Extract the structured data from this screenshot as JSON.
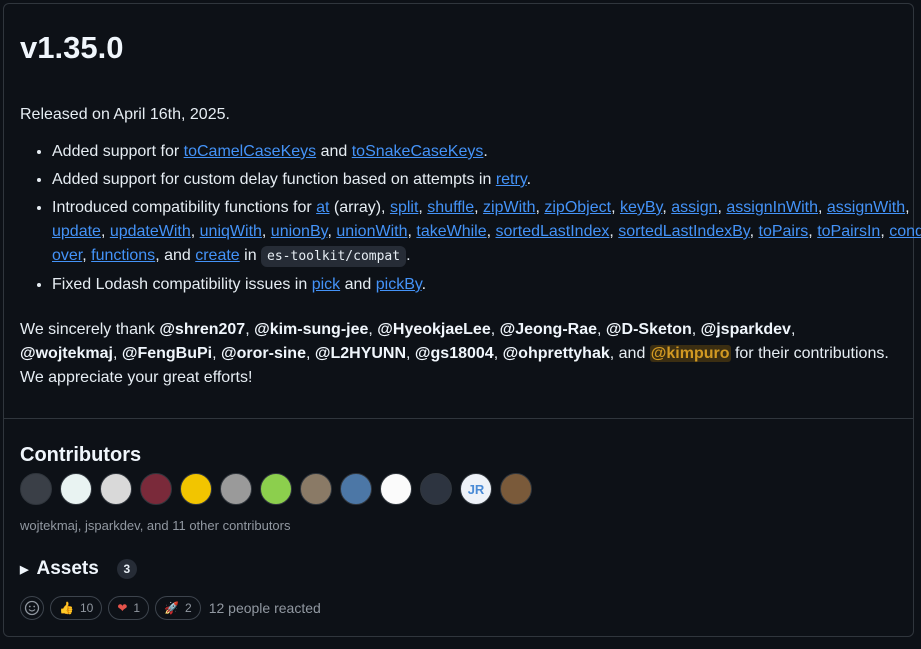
{
  "release": {
    "title": "v1.35.0",
    "released": "Released on April 16th, 2025."
  },
  "bullets": {
    "b1": {
      "pre": "Added support for ",
      "link1": "toCamelCaseKeys",
      "mid": " and ",
      "link2": "toSnakeCaseKeys",
      "post": "."
    },
    "b2": {
      "pre": "Added support for custom delay function based on attempts in ",
      "link": "retry",
      "post": "."
    },
    "b3": {
      "pre": "Introduced compatibility functions for ",
      "at": "at",
      "at_note": " (array)",
      "links": [
        "split",
        "shuffle",
        "zipWith",
        "zipObject",
        "keyBy",
        "assign",
        "assignInWith",
        "assignWith",
        "update",
        "updateWith",
        "uniqWith",
        "unionBy",
        "unionWith",
        "takeWhile",
        "sortedLastIndex",
        "sortedLastIndexBy",
        "toPairs",
        "toPairsIn",
        "cond",
        "over",
        "functions"
      ],
      "and": ", and ",
      "last": "create",
      "in": " in ",
      "code": "es-toolkit/compat",
      "post": "."
    },
    "b4": {
      "pre": "Fixed Lodash compatibility issues in ",
      "link1": "pick",
      "mid": " and ",
      "link2": "pickBy",
      "post": "."
    }
  },
  "thanks": {
    "pre": "We sincerely thank ",
    "mentions": [
      "@shren207",
      "@kim-sung-jee",
      "@HyeokjaeLee",
      "@Jeong-Rae",
      "@D-Sketon",
      "@jsparkdev",
      "@wojtekmaj",
      "@FengBuPi",
      "@oror-sine",
      "@L2HYUNN",
      "@gs18004",
      "@ohprettyhak"
    ],
    "and": ", and ",
    "highlight": "@kimpuro",
    "post": " for their contributions. We appreciate your great efforts!"
  },
  "contributors": {
    "title": "Contributors",
    "avatar_colors": [
      "#3a3f47",
      "#e9f3f2",
      "#d9d9d9",
      "#7a2a3a",
      "#f2c500",
      "#9a9a9a",
      "#8ccf4d",
      "#8a7a66",
      "#4c77a6",
      "#fbfbfb",
      "#2d3440",
      "#eef2f8",
      "#7a5a3a"
    ],
    "avatar_names": [
      "wojtekmaj",
      "jsparkdev",
      "",
      "",
      "",
      "",
      "",
      "",
      "",
      "",
      "",
      "JR",
      ""
    ],
    "note": "wojtekmaj, jsparkdev, and 11 other contributors"
  },
  "assets": {
    "label": "Assets",
    "count": "3"
  },
  "reactions": {
    "thumbs": {
      "emoji": "👍",
      "count": "10"
    },
    "heart": {
      "emoji": "❤",
      "count": "1"
    },
    "rocket": {
      "emoji": "🚀",
      "count": "2"
    },
    "summary": "12 people reacted"
  }
}
